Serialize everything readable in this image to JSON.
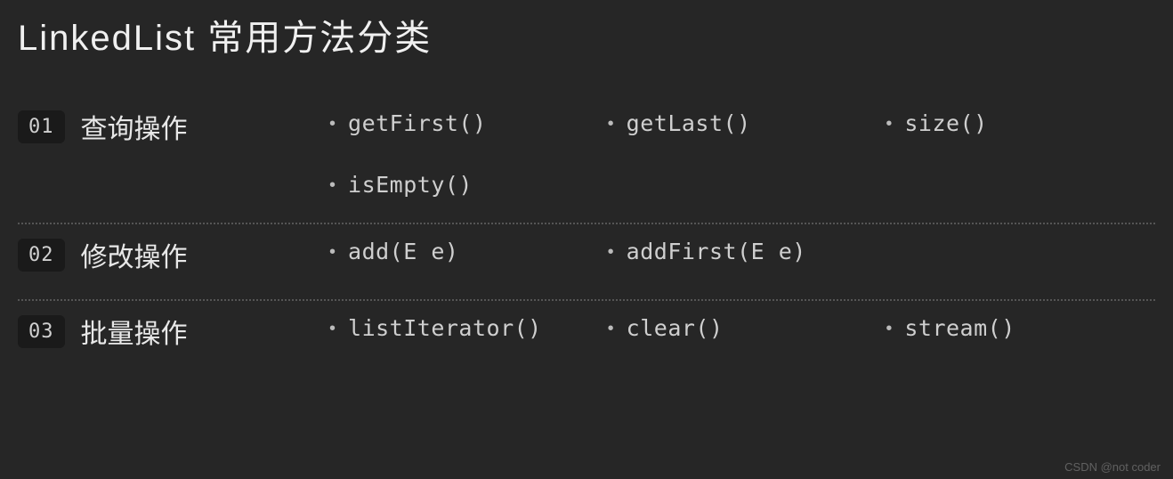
{
  "title": "LinkedList 常用方法分类",
  "sections": [
    {
      "number": "01",
      "title": "查询操作",
      "methods": [
        "getFirst()",
        "getLast()",
        "size()",
        "isEmpty()"
      ]
    },
    {
      "number": "02",
      "title": "修改操作",
      "methods": [
        "add(E e)",
        "addFirst(E e)"
      ]
    },
    {
      "number": "03",
      "title": "批量操作",
      "methods": [
        "listIterator()",
        "clear()",
        "stream()"
      ]
    }
  ],
  "watermark": "CSDN @not coder"
}
